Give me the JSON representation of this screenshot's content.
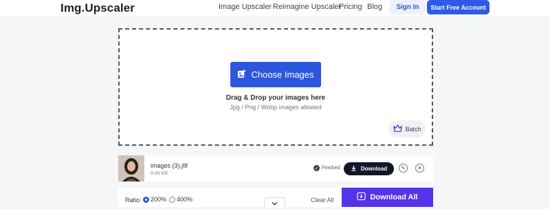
{
  "header": {
    "logo": "Img.Upscaler",
    "nav": [
      "Image Upscaler",
      "Reimagine Upscaler",
      "Pricing",
      "Blog"
    ],
    "sign_in": "Sign In",
    "start": "Start Free Account"
  },
  "upload": {
    "choose_label": "Choose Images",
    "drag_text": "Drag & Drop your images here",
    "formats_text": "Jpg / Png / Webp images allowed",
    "batch_label": "Batch"
  },
  "file": {
    "name": "images (3).jfif",
    "size": "9.88 KB",
    "status": "Finished",
    "download_label": "Download"
  },
  "bottom": {
    "ratio_label": "Ratio:",
    "options": [
      "200%",
      "400%"
    ],
    "selected": "200%",
    "clear_label": "Clear All",
    "download_all_label": "Download All"
  },
  "colors": {
    "primary": "#2c57dc",
    "download_all": "#5533e8",
    "dark_button": "#12162a"
  }
}
